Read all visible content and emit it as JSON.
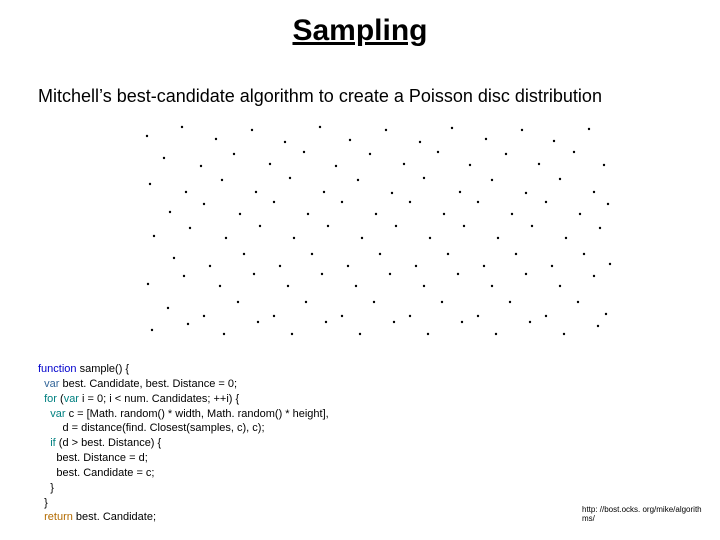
{
  "title": "Sampling",
  "subtitle": "Mitchell’s best-candidate algorithm to create a Poisson disc distribution",
  "code": {
    "l1a": "function",
    "l1b": " sample() {",
    "l2a": "  var",
    "l2b": " best. Candidate, best. Distance = 0;",
    "l3a": "  for",
    "l3b": " (",
    "l3c": "var",
    "l3d": " i = 0; i < num. Candidates; ++i) {",
    "l4a": "    var",
    "l4b": " c = [Math. random() * width, Math. random() * height],",
    "l5": "        d = distance(find. Closest(samples, c), c);",
    "l6a": "    if",
    "l6b": " (d > best. Distance) {",
    "l7": "      best. Distance = d;",
    "l8": "      best. Candidate = c;",
    "l9": "    }",
    "l10": "  }",
    "l11a": "  return",
    "l11b": " best. Candidate;"
  },
  "source_url": "http: //bost.ocks. org/mike/algorithms/",
  "chart_data": {
    "type": "scatter",
    "title": "",
    "xlabel": "",
    "ylabel": "",
    "xlim": [
      0,
      480
    ],
    "ylim": [
      0,
      224
    ],
    "series": [
      {
        "name": "samples",
        "points": [
          [
            13,
            18
          ],
          [
            48,
            9
          ],
          [
            82,
            21
          ],
          [
            118,
            12
          ],
          [
            151,
            24
          ],
          [
            186,
            9
          ],
          [
            216,
            22
          ],
          [
            252,
            12
          ],
          [
            286,
            24
          ],
          [
            318,
            10
          ],
          [
            352,
            21
          ],
          [
            388,
            12
          ],
          [
            420,
            23
          ],
          [
            455,
            11
          ],
          [
            30,
            40
          ],
          [
            67,
            48
          ],
          [
            100,
            36
          ],
          [
            136,
            46
          ],
          [
            170,
            34
          ],
          [
            202,
            48
          ],
          [
            236,
            36
          ],
          [
            270,
            46
          ],
          [
            304,
            34
          ],
          [
            336,
            47
          ],
          [
            372,
            36
          ],
          [
            405,
            46
          ],
          [
            440,
            34
          ],
          [
            470,
            47
          ],
          [
            16,
            66
          ],
          [
            52,
            74
          ],
          [
            88,
            62
          ],
          [
            122,
            74
          ],
          [
            156,
            60
          ],
          [
            190,
            74
          ],
          [
            224,
            62
          ],
          [
            258,
            75
          ],
          [
            290,
            60
          ],
          [
            326,
            74
          ],
          [
            358,
            62
          ],
          [
            392,
            75
          ],
          [
            426,
            61
          ],
          [
            460,
            74
          ],
          [
            36,
            94
          ],
          [
            70,
            86
          ],
          [
            106,
            96
          ],
          [
            140,
            84
          ],
          [
            174,
            96
          ],
          [
            208,
            84
          ],
          [
            242,
            96
          ],
          [
            276,
            84
          ],
          [
            310,
            96
          ],
          [
            344,
            84
          ],
          [
            378,
            96
          ],
          [
            412,
            84
          ],
          [
            446,
            96
          ],
          [
            474,
            86
          ],
          [
            20,
            118
          ],
          [
            56,
            110
          ],
          [
            92,
            120
          ],
          [
            126,
            108
          ],
          [
            160,
            120
          ],
          [
            194,
            108
          ],
          [
            228,
            120
          ],
          [
            262,
            108
          ],
          [
            296,
            120
          ],
          [
            330,
            108
          ],
          [
            364,
            120
          ],
          [
            398,
            108
          ],
          [
            432,
            120
          ],
          [
            466,
            110
          ],
          [
            40,
            140
          ],
          [
            76,
            148
          ],
          [
            110,
            136
          ],
          [
            146,
            148
          ],
          [
            178,
            136
          ],
          [
            214,
            148
          ],
          [
            246,
            136
          ],
          [
            282,
            148
          ],
          [
            314,
            136
          ],
          [
            350,
            148
          ],
          [
            382,
            136
          ],
          [
            418,
            148
          ],
          [
            450,
            136
          ],
          [
            476,
            146
          ],
          [
            14,
            166
          ],
          [
            50,
            158
          ],
          [
            86,
            168
          ],
          [
            120,
            156
          ],
          [
            154,
            168
          ],
          [
            188,
            156
          ],
          [
            222,
            168
          ],
          [
            256,
            156
          ],
          [
            290,
            168
          ],
          [
            324,
            156
          ],
          [
            358,
            168
          ],
          [
            392,
            156
          ],
          [
            426,
            168
          ],
          [
            460,
            158
          ],
          [
            34,
            190
          ],
          [
            70,
            198
          ],
          [
            104,
            184
          ],
          [
            140,
            198
          ],
          [
            172,
            184
          ],
          [
            208,
            198
          ],
          [
            240,
            184
          ],
          [
            276,
            198
          ],
          [
            308,
            184
          ],
          [
            344,
            198
          ],
          [
            376,
            184
          ],
          [
            412,
            198
          ],
          [
            444,
            184
          ],
          [
            472,
            196
          ],
          [
            18,
            212
          ],
          [
            54,
            206
          ],
          [
            90,
            216
          ],
          [
            124,
            204
          ],
          [
            158,
            216
          ],
          [
            192,
            204
          ],
          [
            226,
            216
          ],
          [
            260,
            204
          ],
          [
            294,
            216
          ],
          [
            328,
            204
          ],
          [
            362,
            216
          ],
          [
            396,
            204
          ],
          [
            430,
            216
          ],
          [
            464,
            208
          ]
        ]
      }
    ]
  }
}
